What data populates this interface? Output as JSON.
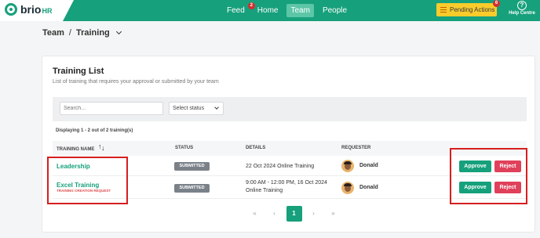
{
  "header": {
    "logo_text": "brio",
    "logo_suffix": "HR",
    "nav": [
      {
        "label": "Feed",
        "badge": "2"
      },
      {
        "label": "Home"
      },
      {
        "label": "Team"
      },
      {
        "label": "People"
      }
    ],
    "pending_actions": {
      "label": "Pending Actions",
      "badge": "6"
    },
    "help": {
      "label": "Help Centre"
    },
    "colors": {
      "primary": "#17a07c",
      "pending": "#f9cc2c",
      "badge": "#d32f2f"
    }
  },
  "breadcrumb": {
    "root": "Team",
    "separator": "/",
    "current": "Training"
  },
  "card": {
    "title": "Training List",
    "subtitle": "List of training that requires your approval or submitted by your team",
    "search_placeholder": "Search...",
    "status_select": "Select status",
    "displaying": "Displaying 1 - 2 out of 2 training(s)",
    "columns": [
      "TRAINING NAME",
      "STATUS",
      "DETAILS",
      "REQUESTER"
    ],
    "rows": [
      {
        "name": "Leadership",
        "tag": "",
        "status": "SUBMITTED",
        "details_line1": "22 Oct 2024 Online Training",
        "details_line2": "",
        "requester": "Donald",
        "approve": "Approve",
        "reject": "Reject"
      },
      {
        "name": "Excel Training",
        "tag": "TRAINING CREATION REQUEST",
        "status": "SUBMITTED",
        "details_line1": "9:00 AM - 12:00 PM, 16 Oct 2024",
        "details_line2": "Online Training",
        "requester": "Donald",
        "approve": "Approve",
        "reject": "Reject"
      }
    ],
    "pagination": {
      "first": "«",
      "prev": "‹",
      "page": "1",
      "next": "›",
      "last": "»"
    }
  }
}
